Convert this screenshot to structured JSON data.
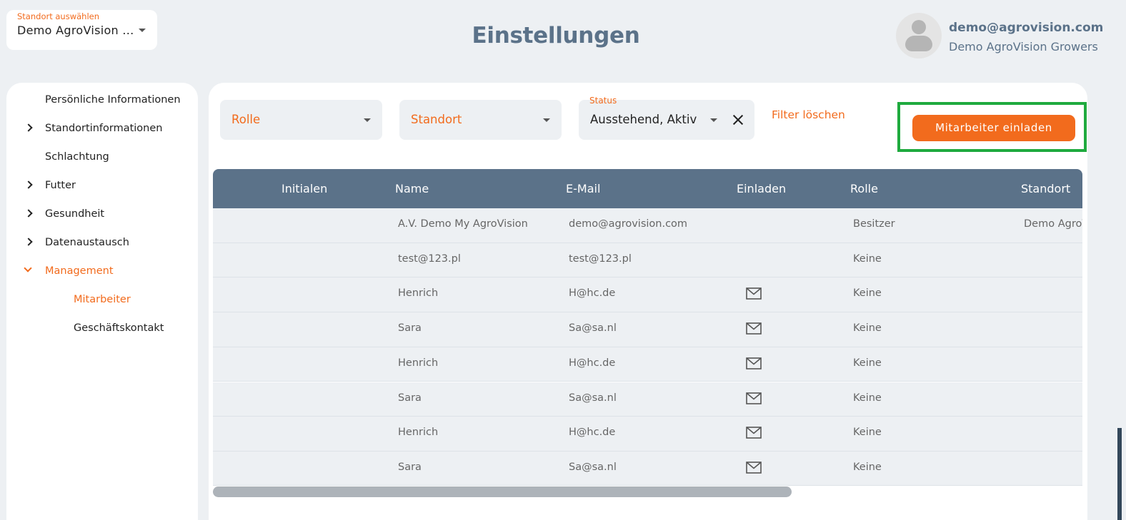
{
  "location_select": {
    "label": "Standort auswählen",
    "value": "Demo AgroVision ..."
  },
  "page_title": "Einstellungen",
  "user": {
    "email": "demo@agrovision.com",
    "company": "Demo AgroVision Growers"
  },
  "sidebar": {
    "items": [
      {
        "label": "Persönliche Informationen",
        "expandable": false
      },
      {
        "label": "Standortinformationen",
        "expandable": true
      },
      {
        "label": "Schlachtung",
        "expandable": false
      },
      {
        "label": "Futter",
        "expandable": true
      },
      {
        "label": "Gesundheit",
        "expandable": true
      },
      {
        "label": "Datenaustausch",
        "expandable": true
      },
      {
        "label": "Management",
        "expandable": true,
        "expanded": true,
        "active": true
      },
      {
        "label": "Mitarbeiter",
        "sub": true,
        "active": true
      },
      {
        "label": "Geschäftskontakt",
        "sub": true
      }
    ]
  },
  "filters": {
    "role": {
      "value": "Rolle"
    },
    "location": {
      "value": "Standort"
    },
    "status": {
      "label": "Status",
      "value": "Ausstehend, Aktiv"
    },
    "clear_label": "Filter löschen"
  },
  "invite_button": "Mitarbeiter einladen",
  "table": {
    "columns": [
      "Initialen",
      "Name",
      "E-Mail",
      "Einladen",
      "Rolle",
      "Standort"
    ],
    "rows": [
      {
        "initials": "",
        "name": "A.V. Demo My AgroVision",
        "email": "demo@agrovision.com",
        "invite": false,
        "role": "Besitzer",
        "location": "Demo AgroV"
      },
      {
        "initials": "",
        "name": "test@123.pl",
        "email": "test@123.pl",
        "invite": false,
        "role": "Keine",
        "location": ""
      },
      {
        "initials": "",
        "name": "Henrich",
        "email": "H@hc.de",
        "invite": true,
        "role": "Keine",
        "location": ""
      },
      {
        "initials": "",
        "name": "Sara",
        "email": "Sa@sa.nl",
        "invite": true,
        "role": "Keine",
        "location": ""
      },
      {
        "initials": "",
        "name": "Henrich",
        "email": "H@hc.de",
        "invite": true,
        "role": "Keine",
        "location": ""
      },
      {
        "initials": "",
        "name": "Sara",
        "email": "Sa@sa.nl",
        "invite": true,
        "role": "Keine",
        "location": ""
      },
      {
        "initials": "",
        "name": "Henrich",
        "email": "H@hc.de",
        "invite": true,
        "role": "Keine",
        "location": ""
      },
      {
        "initials": "",
        "name": "Sara",
        "email": "Sa@sa.nl",
        "invite": true,
        "role": "Keine",
        "location": ""
      }
    ]
  },
  "colors": {
    "accent": "#f26b1d",
    "header": "#5b7289",
    "highlight": "#1faa3e"
  }
}
